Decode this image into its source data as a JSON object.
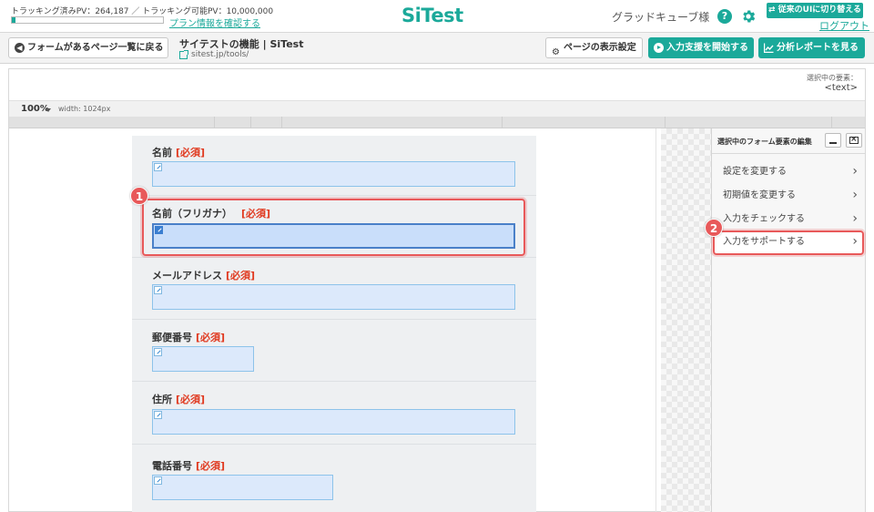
{
  "header": {
    "tracking_text": "トラッキング済みPV：264,187 ／ トラッキング可能PV：10,000,000",
    "tracking_progress": 0.027,
    "plan_link": "プラン情報を確認する",
    "logo_text": "SiTest",
    "user_name": "グラッドキューブ様",
    "help_icon": "?",
    "switch_ui_label": "⇄ 従来のUIに切り替える",
    "logout_label": "ログアウト"
  },
  "toolbar": {
    "back_label": "フォームがあるページ一覧に戻る",
    "page_title": "サイテストの機能 | SiTest",
    "page_url": "sitest.jp/tools/",
    "display_settings_label": "ページの表示設定",
    "start_label": "入力支援を開始する",
    "report_label": "分析レポートを見る"
  },
  "preview": {
    "selected_label": "選択中の要素：",
    "selected_value": "<text>",
    "zoom": "100%",
    "width_label": "width: 1024px"
  },
  "form": {
    "required_label": "[必須]",
    "fields": [
      {
        "label": "名前"
      },
      {
        "label": "名前（フリガナ）"
      },
      {
        "label": "メールアドレス"
      },
      {
        "label": "郵便番号"
      },
      {
        "label": "住所"
      },
      {
        "label": "電話番号"
      }
    ]
  },
  "annotations": {
    "badge_1": "1",
    "badge_2": "2"
  },
  "side_panel": {
    "title": "選択中のフォーム要素の編集",
    "items": [
      {
        "label": "設定を変更する"
      },
      {
        "label": "初期値を変更する"
      },
      {
        "label": "入力をチェックする"
      },
      {
        "label": "入力をサポートする"
      }
    ]
  },
  "colors": {
    "accent": "#1ba99a",
    "highlight": "#e8595a",
    "required": "#e0381e",
    "input_fill": "#dce9fb"
  }
}
